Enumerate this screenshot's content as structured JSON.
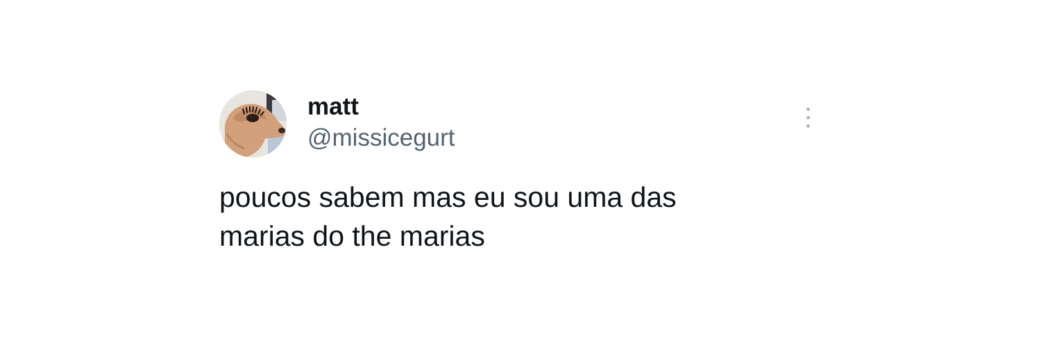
{
  "tweet": {
    "author": {
      "display_name": "matt",
      "handle": "@missicegurt",
      "avatar_icon": "dog-with-eyelashes-avatar"
    },
    "text_lines": [
      "poucos sabem mas eu sou uma das",
      "marias do the marias"
    ],
    "more_icon": "vertical-ellipsis-icon"
  },
  "colors": {
    "text_primary": "#0f1419",
    "text_secondary": "#536471",
    "icon_muted": "#aab8c2",
    "background": "#ffffff"
  }
}
